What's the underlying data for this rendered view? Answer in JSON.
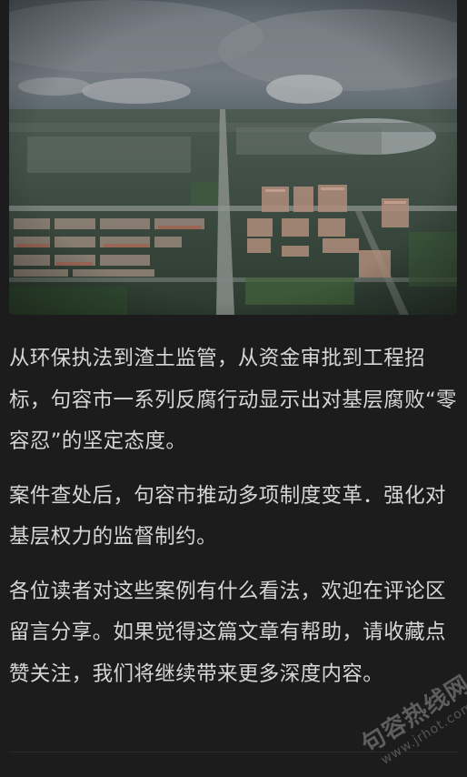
{
  "article": {
    "paragraphs": [
      "从环保执法到渣土监管，从资金审批到工程招标，句容市一系列反腐行动显示出对基层腐败“零容忍”的坚定态度。",
      "案件查处后，句容市推动多项制度变革．强化对基层权力的监督制约。",
      "各位读者对这些案例有什么看法，欢迎在评论区留言分享。如果觉得这篇文章有帮助，请收藏点赞关注，我们将继续带来更多深度内容。"
    ]
  },
  "watermark": {
    "main": "句容热线网",
    "sub": "www.jrhot.com"
  },
  "colors": {
    "background": "#1c1c1c",
    "text": "#d6d6d6"
  }
}
